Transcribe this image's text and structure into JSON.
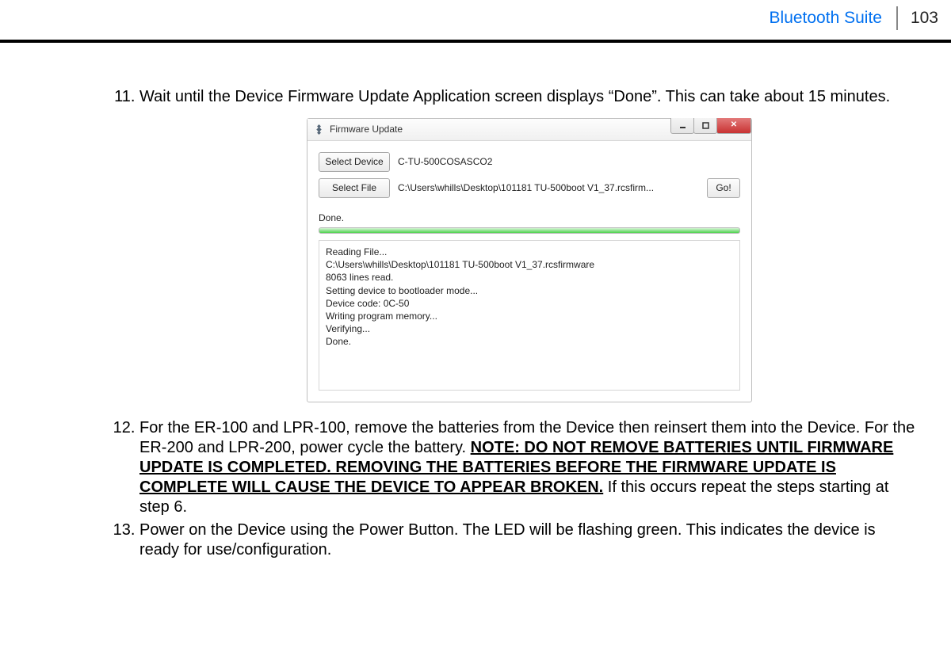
{
  "header": {
    "label": "Bluetooth Suite",
    "page_number": "103"
  },
  "steps": {
    "item11": "Wait until the Device Firmware Update Application screen displays “Done”. This can take about 15 minutes.",
    "item12_a": "For the ER-100 and LPR-100, remove the batteries from the Device then reinsert them into the Device. For the ER-200 and LPR-200, power cycle the battery. ",
    "item12_note": "NOTE: DO NOT REMOVE BATTERIES UNTIL FIRMWARE UPDATE IS COMPLETED. REMOVING THE BATTERIES BEFORE THE FIRMWARE UPDATE IS COMPLETE WILL CAUSE THE DEVICE TO APPEAR BROKEN.",
    "item12_b": " If this occurs repeat the steps starting at step 6.",
    "item13": "Power on the Device using the Power Button. The LED will be flashing green. This indicates the device is ready for use/configuration."
  },
  "window": {
    "title": "Firmware Update",
    "select_device": "Select Device",
    "device_value": "C-TU-500COSASCO2",
    "select_file": "Select File",
    "file_value": "C:\\Users\\whills\\Desktop\\101181 TU-500boot V1_37.rcsfirm...",
    "go": "Go!",
    "status": "Done.",
    "log": {
      "l1": "Reading File...",
      "l2": "C:\\Users\\whills\\Desktop\\101181 TU-500boot V1_37.rcsfirmware",
      "l3": "8063 lines read.",
      "l4": "",
      "l5": "Setting device to bootloader mode...",
      "l6": "Device code: 0C-50",
      "l7": "Writing program memory...",
      "l8": "Verifying...",
      "l9": "Done."
    }
  }
}
